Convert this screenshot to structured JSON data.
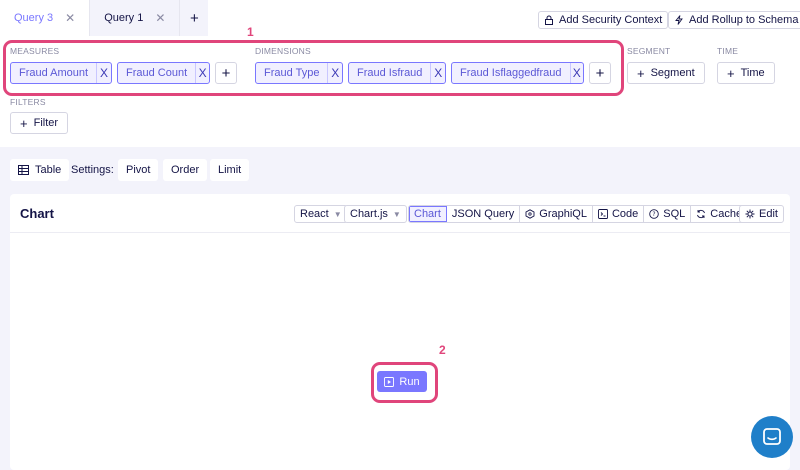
{
  "tabs": [
    {
      "label": "Query 3",
      "active": true
    },
    {
      "label": "Query 1",
      "active": false
    }
  ],
  "tab_add_glyph": "+",
  "top_actions": {
    "security_label": "Add Security Context",
    "rollup_label": "Add Rollup to Schema"
  },
  "measures": {
    "label": "MEASURES",
    "items": [
      "Fraud Amount",
      "Fraud Count"
    ]
  },
  "dimensions": {
    "label": "DIMENSIONS",
    "items": [
      "Fraud Type",
      "Fraud Isfraud",
      "Fraud Isflaggedfraud"
    ]
  },
  "segment": {
    "label": "SEGMENT",
    "button": "Segment"
  },
  "time": {
    "label": "TIME",
    "button": "Time"
  },
  "filters": {
    "label": "FILTERS",
    "button": "Filter"
  },
  "remove_glyph": "X",
  "add_glyph": "+",
  "annotations": [
    "1",
    "2"
  ],
  "settings_bar": {
    "table_label": "Table",
    "settings_label": "Settings:",
    "pivot_label": "Pivot",
    "order_label": "Order",
    "limit_label": "Limit"
  },
  "chart_card": {
    "title": "Chart",
    "framework": "React",
    "library": "Chart.js",
    "view_tabs": [
      "Chart",
      "JSON Query",
      "GraphiQL",
      "Code",
      "SQL",
      "Cache"
    ],
    "active_view": "Chart",
    "edit_label": "Edit",
    "run_label": "Run"
  },
  "colors": {
    "accent": "#7a77ff",
    "annotation": "#e0457b",
    "chat": "#1f7fc9"
  },
  "icons": [
    "lock-icon",
    "rollup-icon",
    "table-icon",
    "graphiql-icon",
    "code-icon",
    "sql-icon",
    "cache-icon",
    "edit-icon",
    "play-icon",
    "chat-icon"
  ]
}
